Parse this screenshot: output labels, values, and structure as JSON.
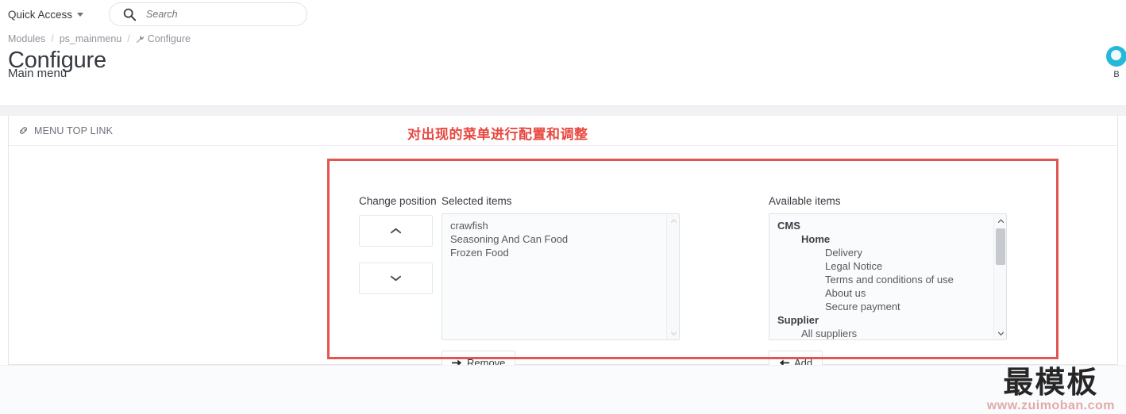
{
  "topbar": {
    "quick_access_label": "Quick Access",
    "search_placeholder": "Search",
    "search_value": "",
    "search_icon": "search-icon",
    "caret_icon": "chevron-down-icon"
  },
  "employee": {
    "name": "B",
    "avatar_color": "#25b9d7"
  },
  "breadcrumb": {
    "items": [
      {
        "label": "Modules"
      },
      {
        "label": "ps_mainmenu"
      },
      {
        "label": "Configure",
        "icon": "wrench-icon"
      }
    ],
    "separator": "/"
  },
  "page": {
    "title": "Configure",
    "subtitle": "Main menu"
  },
  "panel": {
    "header_title": "MENU TOP LINK",
    "header_icon": "link-icon"
  },
  "annotation": {
    "text": "对出现的菜单进行配置和调整",
    "color": "#e8473f"
  },
  "highlight": {
    "color": "#e2564f"
  },
  "transfer": {
    "change_position_label": "Change position",
    "selected_items_label": "Selected items",
    "available_items_label": "Available items",
    "move_up_icon": "chevron-up-icon",
    "move_down_icon": "chevron-down-icon",
    "selected_items": [
      {
        "label": "crawfish",
        "level": 0
      },
      {
        "label": "Seasoning And Can Food",
        "level": 0
      },
      {
        "label": "Frozen Food",
        "level": 0
      }
    ],
    "available_items": [
      {
        "label": "CMS",
        "level": 0,
        "group": true
      },
      {
        "label": "Home",
        "level": 1,
        "group": true
      },
      {
        "label": "Delivery",
        "level": 2,
        "group": false
      },
      {
        "label": "Legal Notice",
        "level": 2,
        "group": false
      },
      {
        "label": "Terms and conditions of use",
        "level": 2,
        "group": false
      },
      {
        "label": "About us",
        "level": 2,
        "group": false
      },
      {
        "label": "Secure payment",
        "level": 2,
        "group": false
      },
      {
        "label": "Supplier",
        "level": 0,
        "group": true
      },
      {
        "label": "All suppliers",
        "level": 1,
        "group": false
      }
    ],
    "remove_label": "Remove",
    "remove_icon": "arrow-right-icon",
    "add_label": "Add",
    "add_icon": "arrow-left-icon"
  },
  "watermark": {
    "main": "最模板",
    "sub": "www.zuimoban.com"
  }
}
